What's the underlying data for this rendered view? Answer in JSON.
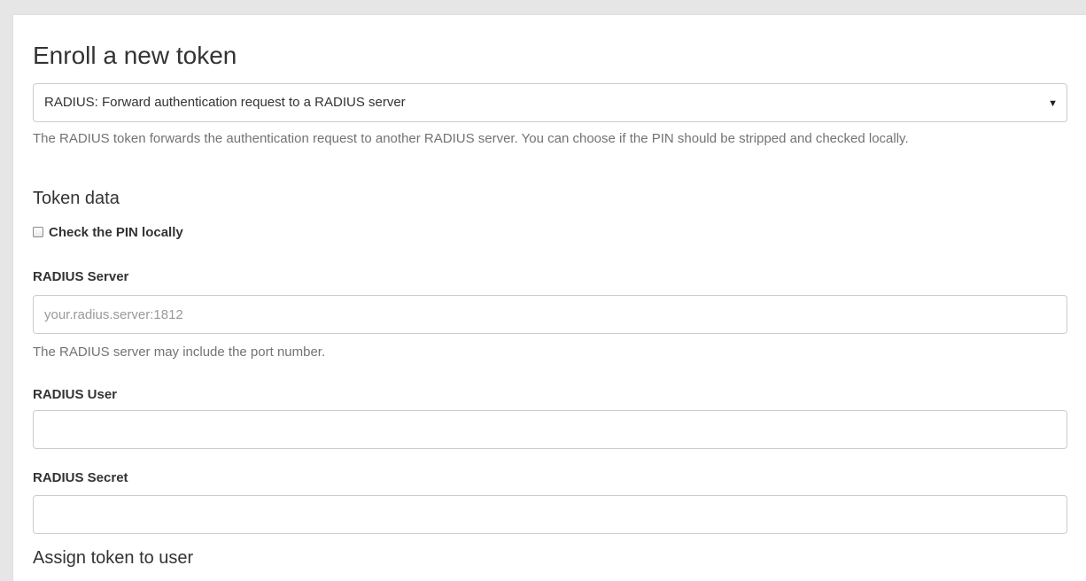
{
  "page": {
    "title": "Enroll a new token"
  },
  "token_type": {
    "selected": "RADIUS: Forward authentication request to a RADIUS server",
    "arrow": "▼",
    "description": "The RADIUS token forwards the authentication request to another RADIUS server. You can choose if the PIN should be stripped and checked locally."
  },
  "token_data": {
    "title": "Token data",
    "check_pin": {
      "label": "Check the PIN locally",
      "checked": false
    },
    "radius_server": {
      "label": "RADIUS Server",
      "placeholder": "your.radius.server:1812",
      "value": "",
      "help": "The RADIUS server may include the port number."
    },
    "radius_user": {
      "label": "RADIUS User",
      "value": ""
    },
    "radius_secret": {
      "label": "RADIUS Secret",
      "value": ""
    }
  },
  "next_section": {
    "title": "Assign token to user"
  }
}
